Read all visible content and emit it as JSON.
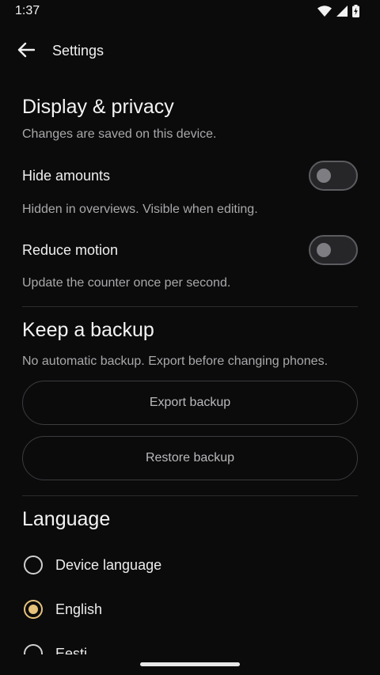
{
  "status_bar": {
    "time": "1:37"
  },
  "top_bar": {
    "title": "Settings"
  },
  "display_privacy": {
    "title": "Display & privacy",
    "caption": "Changes are saved on this device.",
    "hide_amounts": {
      "label": "Hide amounts",
      "caption": "Hidden in overviews. Visible when editing.",
      "on": false
    },
    "reduce_motion": {
      "label": "Reduce motion",
      "caption": "Update the counter once per second.",
      "on": false
    }
  },
  "backup": {
    "title": "Keep a backup",
    "caption": "No automatic backup. Export before changing phones.",
    "export_label": "Export backup",
    "restore_label": "Restore backup"
  },
  "language": {
    "title": "Language",
    "options": [
      {
        "label": "Device language",
        "selected": false
      },
      {
        "label": "English",
        "selected": true
      },
      {
        "label": "Eesti",
        "selected": false
      }
    ]
  },
  "colors": {
    "accent": "#e6c27a",
    "background": "#0b0b0c"
  }
}
